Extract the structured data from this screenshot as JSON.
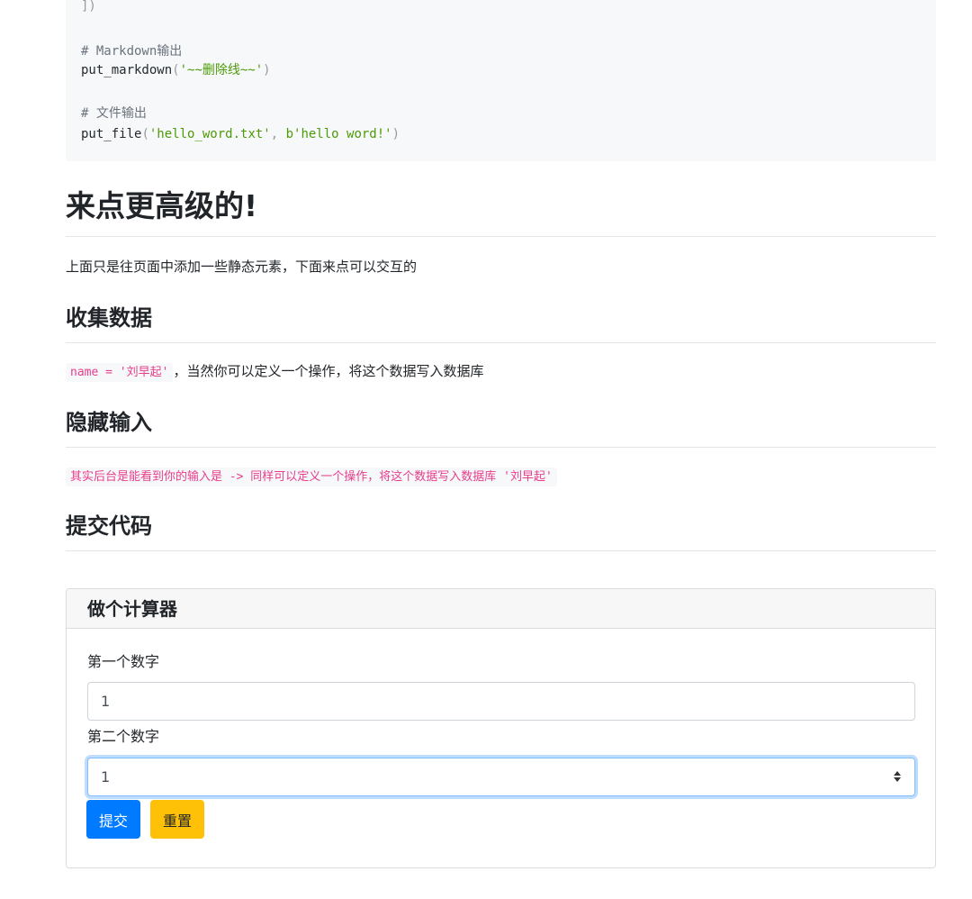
{
  "code": {
    "line1": "])",
    "comment_markdown": "# Markdown输出",
    "markdown_fn": "put_markdown",
    "markdown_arg": "'~~删除线~~'",
    "comment_file": "# 文件输出",
    "file_fn": "put_file",
    "file_arg1": "'hello_word.txt'",
    "file_arg2": "b'hello word!'"
  },
  "section_advanced": {
    "title": "来点更高级的!",
    "intro": "上面只是往页面中添加一些静态元素，下面来点可以交互的"
  },
  "section_collect": {
    "title": "收集数据",
    "code": "name = '刘早起'",
    "text": "，当然你可以定义一个操作，将这个数据写入数据库"
  },
  "section_hidden": {
    "title": "隐藏输入",
    "code": "其实后台是能看到你的输入是 -> 同样可以定义一个操作，将这个数据写入数据库 '刘早起'"
  },
  "section_submit": {
    "title": "提交代码"
  },
  "calculator": {
    "title": "做个计算器",
    "first_label": "第一个数字",
    "first_value": "1",
    "second_label": "第二个数字",
    "second_value": "1",
    "submit_label": "提交",
    "reset_label": "重置"
  }
}
